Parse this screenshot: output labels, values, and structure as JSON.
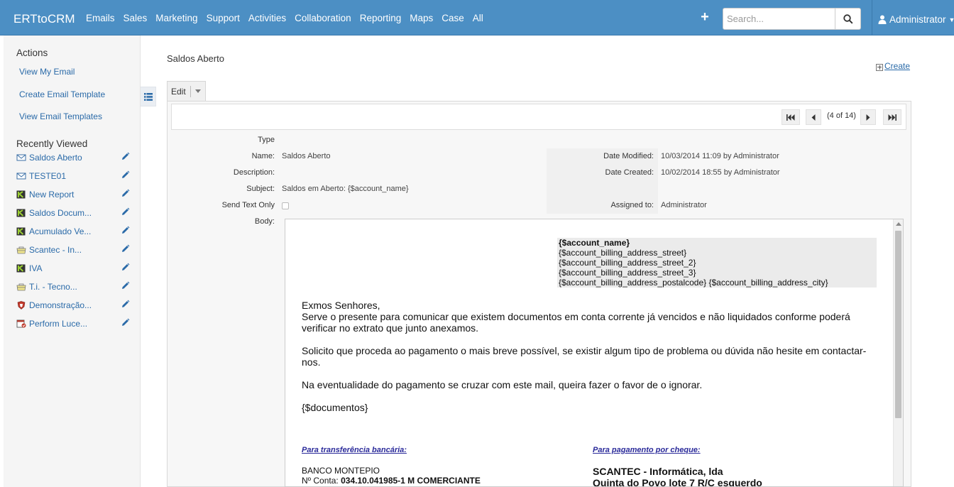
{
  "app": {
    "brand": "ERTtoCRM"
  },
  "nav": {
    "menu": [
      "Emails",
      "Sales",
      "Marketing",
      "Support",
      "Activities",
      "Collaboration",
      "Reporting",
      "Maps",
      "Case",
      "All"
    ],
    "search_placeholder": "Search...",
    "user": "Administrator",
    "accent_color": "#4c8fc4"
  },
  "sidebar": {
    "actions_title": "Actions",
    "actions": [
      "View My Email",
      "Create Email Template",
      "View Email Templates"
    ],
    "recent_title": "Recently Viewed",
    "recent": [
      {
        "label": "Saldos Aberto",
        "icon": "email-template-icon"
      },
      {
        "label": "TESTE01",
        "icon": "email-template-icon"
      },
      {
        "label": "New Report",
        "icon": "report-icon"
      },
      {
        "label": "Saldos Docum...",
        "icon": "report-icon"
      },
      {
        "label": "Acumulado Ve...",
        "icon": "report-icon"
      },
      {
        "label": "Scantec - In...",
        "icon": "account-icon"
      },
      {
        "label": "IVA",
        "icon": "report-icon"
      },
      {
        "label": "T.i. - Tecno...",
        "icon": "account-icon"
      },
      {
        "label": "Demonstração...",
        "icon": "shield-icon"
      },
      {
        "label": "Perform Luce...",
        "icon": "calendar-icon"
      }
    ]
  },
  "record": {
    "title": "Saldos Aberto",
    "create_label": "Create",
    "edit_label": "Edit",
    "pagination": "(4 of 14)",
    "labels": {
      "type": "Type",
      "name": "Name:",
      "description": "Description:",
      "subject": "Subject:",
      "send_text_only": "Send Text Only",
      "body": "Body:",
      "date_modified": "Date Modified:",
      "date_created": "Date Created:",
      "assigned_to": "Assigned to:"
    },
    "values": {
      "name": "Saldos Aberto",
      "subject": "Saldos em Aberto: {$account_name}",
      "date_modified": "10/03/2014 11:09 by Administrator",
      "date_created": "10/02/2014 18:55 by Administrator",
      "assigned_to": "Administrator",
      "send_text_only": false
    }
  },
  "email_body": {
    "address": [
      "{$account_name}",
      "{$account_billing_address_street}",
      "{$account_billing_address_street_2}",
      "{$account_billing_address_street_3}",
      "{$account_billing_address_postalcode} {$account_billing_address_city}"
    ],
    "greeting": "Exmos Senhores,",
    "para1": "Serve o presente para comunicar que existem documentos em conta corrente já vencidos e não liquidados conforme poderá verificar no extrato que junto anexamos.",
    "para2": "Solicito que proceda ao pagamento o mais breve possível, se existir algum tipo de problema ou dúvida não hesite em contactar-nos.",
    "para3": "Na eventualidade do pagamento se cruzar com este mail, queira fazer o favor de o ignorar.",
    "placeholder": "{$documentos}",
    "transfer_heading": "Para transferência bancária:",
    "cheque_heading": "Para pagamento por cheque:",
    "bank_name": "BANCO MONTEPIO",
    "account_label": "Nº Conta:",
    "account_value": "034.10.041985-1 M COMERCIANTE",
    "company_name": "SCANTEC - Informática, lda",
    "company_address": "Quinta do Povo lote 7 R/C esquerdo"
  }
}
